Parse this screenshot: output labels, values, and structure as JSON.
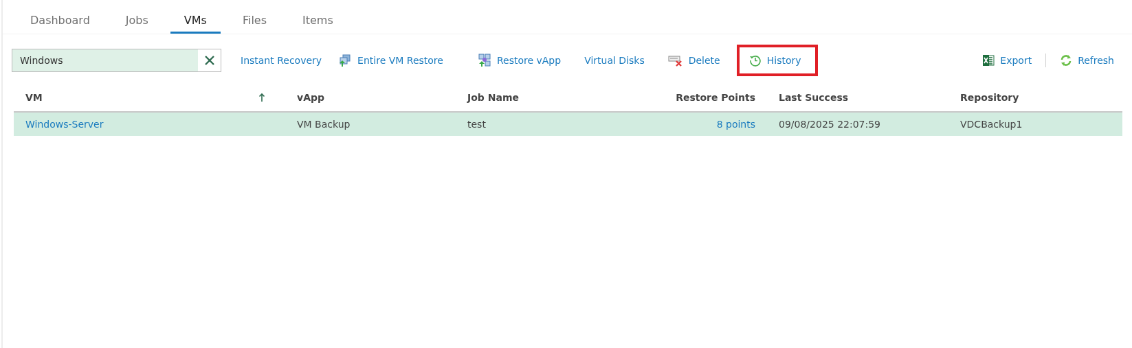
{
  "tabs": [
    {
      "label": "Dashboard",
      "selected": false
    },
    {
      "label": "Jobs",
      "selected": false
    },
    {
      "label": "VMs",
      "selected": true
    },
    {
      "label": "Files",
      "selected": false
    },
    {
      "label": "Items",
      "selected": false
    }
  ],
  "search": {
    "value": "Windows"
  },
  "toolbar": [
    {
      "label": "Instant Recovery",
      "kind": "plain",
      "highlighted": false
    },
    {
      "label": "Entire VM Restore",
      "kind": "vm",
      "highlighted": false
    },
    {
      "label": "Restore vApp",
      "kind": "vapp",
      "highlighted": false
    },
    {
      "label": "Virtual Disks",
      "kind": "plain",
      "highlighted": false
    },
    {
      "label": "Delete",
      "kind": "delete",
      "highlighted": false
    },
    {
      "label": "History",
      "kind": "history",
      "highlighted": true
    }
  ],
  "toolbar_right": [
    {
      "label": "Export",
      "kind": "export"
    },
    {
      "label": "Refresh",
      "kind": "refresh"
    }
  ],
  "table": {
    "columns": [
      {
        "label": "VM",
        "sorted": true
      },
      {
        "label": "vApp",
        "sorted": false
      },
      {
        "label": "Job Name",
        "sorted": false
      },
      {
        "label": "Restore Points",
        "sorted": false
      },
      {
        "label": "Last Success",
        "sorted": false
      },
      {
        "label": "Repository",
        "sorted": false
      }
    ],
    "rows": [
      {
        "selected": true,
        "cells": [
          {
            "text": "Windows-Server",
            "link": true
          },
          {
            "text": "VM Backup",
            "link": false
          },
          {
            "text": "test",
            "link": false
          },
          {
            "text": "8 points",
            "link": true
          },
          {
            "text": "09/08/2025 22:07:59",
            "link": false
          },
          {
            "text": "VDCBackup1",
            "link": false
          }
        ]
      }
    ]
  }
}
